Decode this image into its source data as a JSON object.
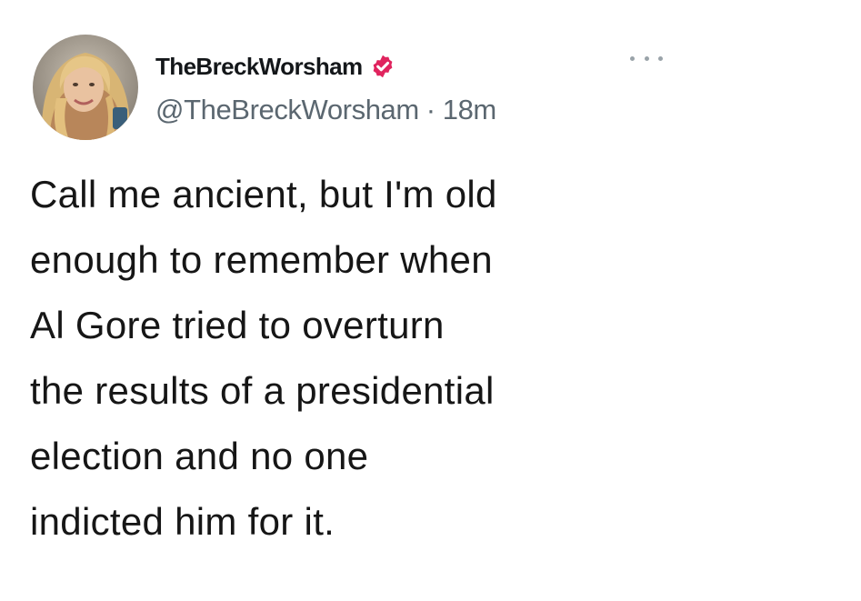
{
  "tweet": {
    "display_name": "TheBreckWorsham",
    "handle": "@TheBreckWorsham",
    "separator": "·",
    "time": "18m",
    "verified": true,
    "lines": [
      "Call me ancient, but I'm old",
      "enough to remember when",
      "Al Gore tried to overturn",
      "the results of a presidential",
      "election and no one",
      "indicted him for it."
    ]
  },
  "icons": {
    "avatar": "profile-photo",
    "verified": "verified-badge-icon",
    "more": "more-options-icon"
  },
  "colors": {
    "verified_badge": "#e0245e",
    "text": "#161616",
    "secondary_text": "#5b6770",
    "background": "#ffffff"
  }
}
